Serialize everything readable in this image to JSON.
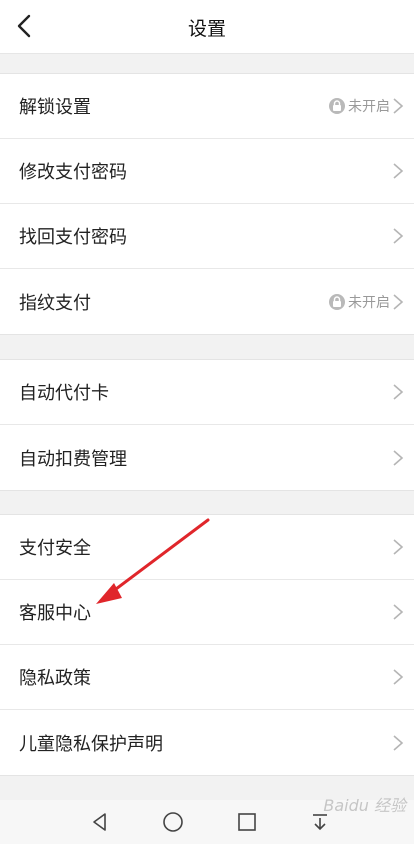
{
  "header": {
    "title": "设置",
    "back_icon": "back-chevron-icon"
  },
  "groups": [
    {
      "rows": [
        {
          "label": "解锁设置",
          "status": "未开启",
          "lock": true
        },
        {
          "label": "修改支付密码"
        },
        {
          "label": "找回支付密码"
        },
        {
          "label": "指纹支付",
          "status": "未开启",
          "lock": true
        }
      ]
    },
    {
      "rows": [
        {
          "label": "自动代付卡"
        },
        {
          "label": "自动扣费管理"
        }
      ]
    },
    {
      "rows": [
        {
          "label": "支付安全"
        },
        {
          "label": "客服中心"
        },
        {
          "label": "隐私政策"
        },
        {
          "label": "儿童隐私保护声明"
        }
      ]
    }
  ],
  "annotation": {
    "color": "#e0262b",
    "points_to": "客服中心"
  },
  "navbar": {
    "icons": [
      "back-triangle-icon",
      "home-circle-icon",
      "recents-square-icon",
      "down-arrow-icon"
    ]
  },
  "watermark": "Baidu 经验"
}
